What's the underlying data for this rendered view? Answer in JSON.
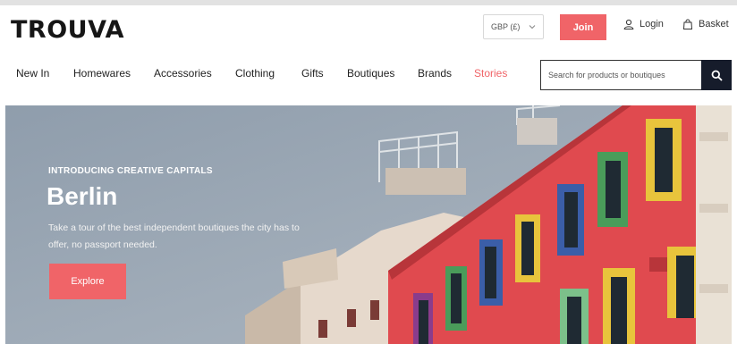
{
  "header": {
    "logo": "TROUVA",
    "currency": "GBP (£)",
    "join_label": "Join",
    "login_label": "Login",
    "basket_label": "Basket"
  },
  "nav": {
    "items": [
      {
        "label": "New In"
      },
      {
        "label": "Homewares"
      },
      {
        "label": "Accessories"
      },
      {
        "label": "Clothing"
      },
      {
        "label": "Gifts"
      },
      {
        "label": "Boutiques"
      },
      {
        "label": "Brands"
      },
      {
        "label": "Stories"
      }
    ]
  },
  "search": {
    "placeholder": "Search for products or boutiques"
  },
  "hero": {
    "eyebrow": "INTRODUCING CREATIVE CAPITALS",
    "city": "Berlin",
    "description": "Take a tour of the best independent boutiques the city has to offer, no passport needed.",
    "cta_label": "Explore"
  },
  "colors": {
    "accent": "#f06468",
    "dark": "#161c2b"
  },
  "icons": {
    "currency_dropdown": "chevron-down-icon",
    "login": "user-icon",
    "basket": "bag-icon",
    "search": "search-icon"
  }
}
